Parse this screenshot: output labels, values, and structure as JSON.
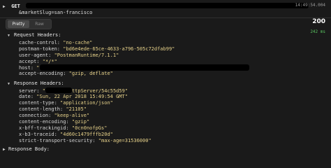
{
  "request": {
    "method": "GET",
    "url_continuation": "&marketSlug=san-francisco",
    "timestamp": "14:49:54.004",
    "section_label": "Request Headers:",
    "headers": [
      {
        "key": "cache-control:",
        "value": "\"no-cache\""
      },
      {
        "key": "postman-token:",
        "value": "\"bd6e4ede-65ce-4633-a796-505c72dfab99\""
      },
      {
        "key": "user-agent:",
        "value": "\"PostmanRuntime/7.1.1\""
      },
      {
        "key": "accept:",
        "value": "\"*/*\""
      },
      {
        "key": "host:",
        "value": "\""
      },
      {
        "key": "accept-encoding:",
        "value": "\"gzip, deflate\""
      }
    ]
  },
  "view_tabs": {
    "pretty": "Pretty",
    "raw": "Raw"
  },
  "response": {
    "status_code": "200",
    "duration": "242 ms",
    "section_label": "Response Headers:",
    "server_value_suffix": "ttpServer/54c55d59\"",
    "headers": [
      {
        "key": "server:",
        "value": "\""
      },
      {
        "key": "date:",
        "value": "\"Sun, 22 Apr 2018 15:49:54 GMT\""
      },
      {
        "key": "content-type:",
        "value": "\"application/json\""
      },
      {
        "key": "content-length:",
        "value": "\"21105\""
      },
      {
        "key": "connection:",
        "value": "\"keep-alive\""
      },
      {
        "key": "content-encoding:",
        "value": "\"gzip\""
      },
      {
        "key": "x-bff-trackingid:",
        "value": "\"0cn0nofpGs\""
      },
      {
        "key": "x-b3-traceid:",
        "value": "\"4d60c1479fffb20d\""
      },
      {
        "key": "strict-transport-security:",
        "value": "\"max-age=31536000\""
      }
    ],
    "body_label": "Response Body:"
  },
  "icons": {
    "expand": "chevron-right-icon",
    "collapse": "caret-down-icon"
  },
  "colors": {
    "background": "#1a1a1a",
    "value_text": "#e7d28a",
    "status_ok": "#58c05e"
  }
}
